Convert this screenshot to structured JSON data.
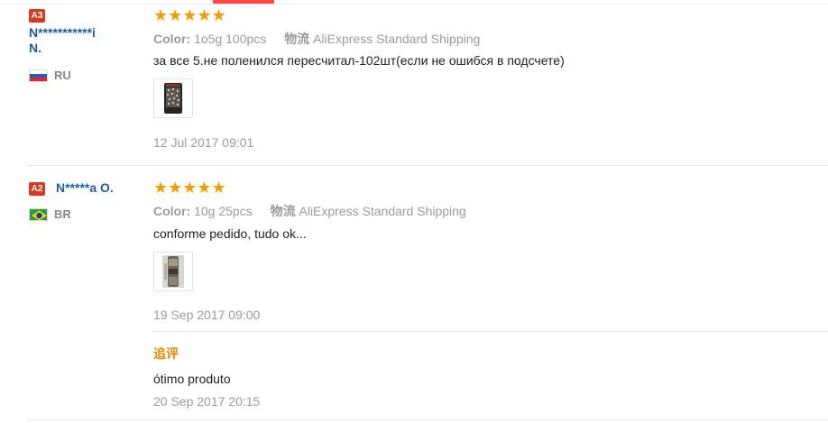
{
  "colors": {
    "accent": "#ff4747",
    "badge": "#d9391f",
    "name": "#1b5ea3",
    "star": "#f59b00",
    "followup": "#e88a00"
  },
  "reviews": [
    {
      "level_badge": "A3",
      "name_line1": "N***********i",
      "name_line2": "N.",
      "country": "RU",
      "flag_icon": "russia-flag-icon",
      "rating": 5,
      "stars": "★★★★★",
      "color_label": "Color:",
      "color_value": "1o5g 100pcs",
      "shipping_label": "物流",
      "shipping_value": "AliExpress Standard Shipping",
      "text": "за все 5.не поленился пересчитал-102шт(если не ошибся в подсчете)",
      "date": "12 Jul 2017 09:01"
    },
    {
      "level_badge": "A2",
      "name": "N*****a O.",
      "country": "BR",
      "flag_icon": "brazil-flag-icon",
      "rating": 5,
      "stars": "★★★★★",
      "color_label": "Color:",
      "color_value": "10g 25pcs",
      "shipping_label": "物流",
      "shipping_value": "AliExpress Standard Shipping",
      "text": "conforme pedido, tudo ok...",
      "date": "19 Sep 2017 09:00",
      "followup": {
        "label": "追评",
        "text": "ótimo produto",
        "date": "20 Sep 2017 20:15"
      }
    }
  ]
}
